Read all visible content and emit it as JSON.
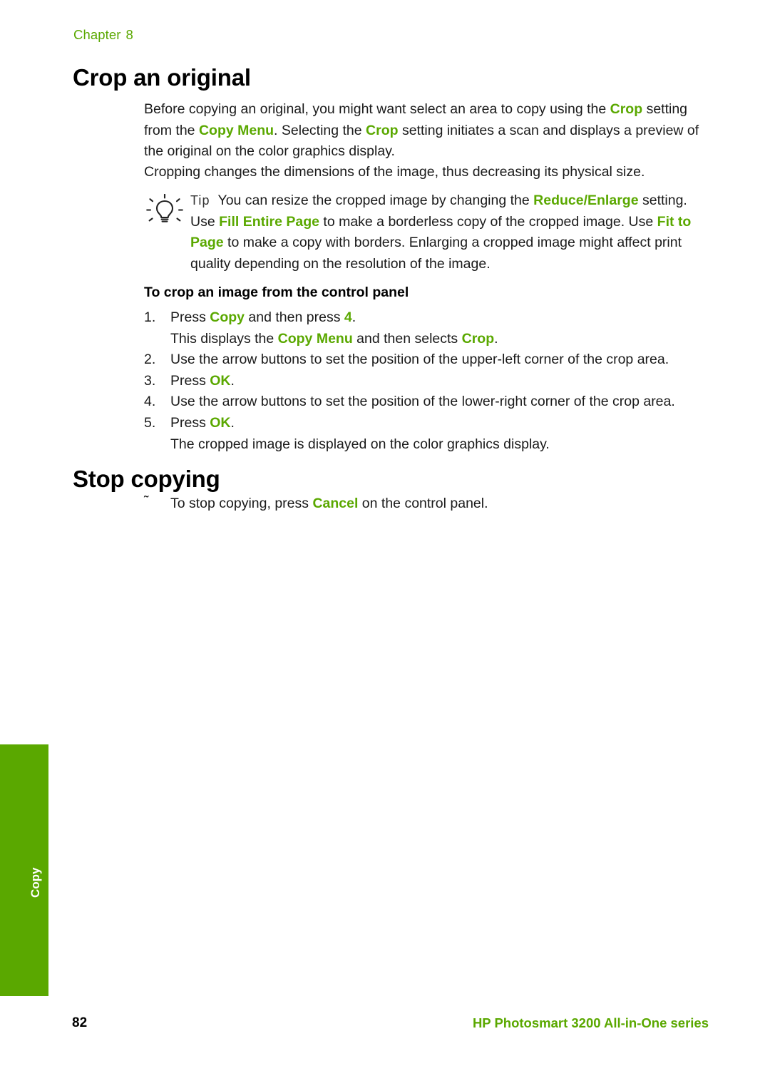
{
  "chapter": {
    "label": "Chapter",
    "number": "8"
  },
  "headings": {
    "crop": "Crop an original",
    "stop": "Stop copying",
    "procedure": "To crop an image from the control panel"
  },
  "paragraphs": {
    "intro_1a": "Before copying an original, you might want select an area to copy using the ",
    "intro_crop": "Crop",
    "intro_1b": "setting from the ",
    "intro_copymenu": "Copy Menu",
    "intro_1c": ". Selecting the ",
    "intro_crop2": "Crop",
    "intro_1d": " setting initiates a scan and displays a preview of the original on the color graphics display.",
    "intro_2": "Cropping changes the dimensions of the image, thus decreasing its physical size."
  },
  "tip": {
    "label": "Tip",
    "text_a": "You can resize the cropped image by changing the ",
    "reduce_enlarge": "Reduce/Enlarge",
    "text_b": "setting. Use ",
    "fill_entire_page": "Fill Entire Page",
    "text_c": " to make a borderless copy of the cropped image. Use ",
    "fit_to_page": "Fit to Page",
    "text_d": " to make a copy with borders. Enlarging a cropped image might affect print quality depending on the resolution of the image."
  },
  "steps": [
    {
      "marker": "1.",
      "pre": "Press ",
      "kw1": "Copy",
      "mid": " and then press ",
      "kw2": "4",
      "post": ".",
      "sub_pre": "This displays the ",
      "sub_kw1": "Copy Menu",
      "sub_mid": " and then selects ",
      "sub_kw2": "Crop",
      "sub_post": "."
    },
    {
      "marker": "2.",
      "text": "Use the arrow buttons to set the position of the upper-left corner of the crop area."
    },
    {
      "marker": "3.",
      "pre": "Press ",
      "kw1": "OK",
      "post": "."
    },
    {
      "marker": "4.",
      "text": "Use the arrow buttons to set the position of the lower-right corner of the crop area."
    },
    {
      "marker": "5.",
      "pre": "Press ",
      "kw1": "OK",
      "post": ".",
      "sub_text": "The cropped image is displayed on the color graphics display."
    }
  ],
  "stop_section": {
    "marker": "˜",
    "pre": "To stop copying, press ",
    "kw": "Cancel",
    "post": " on the control panel."
  },
  "side_tab": {
    "label": "Copy"
  },
  "footer": {
    "page_number": "82",
    "product": "HP Photosmart 3200 All-in-One series"
  },
  "colors": {
    "accent_green": "#5aa800",
    "text": "#1a1a1a"
  },
  "icons": {
    "tip": "lightbulb-icon"
  }
}
